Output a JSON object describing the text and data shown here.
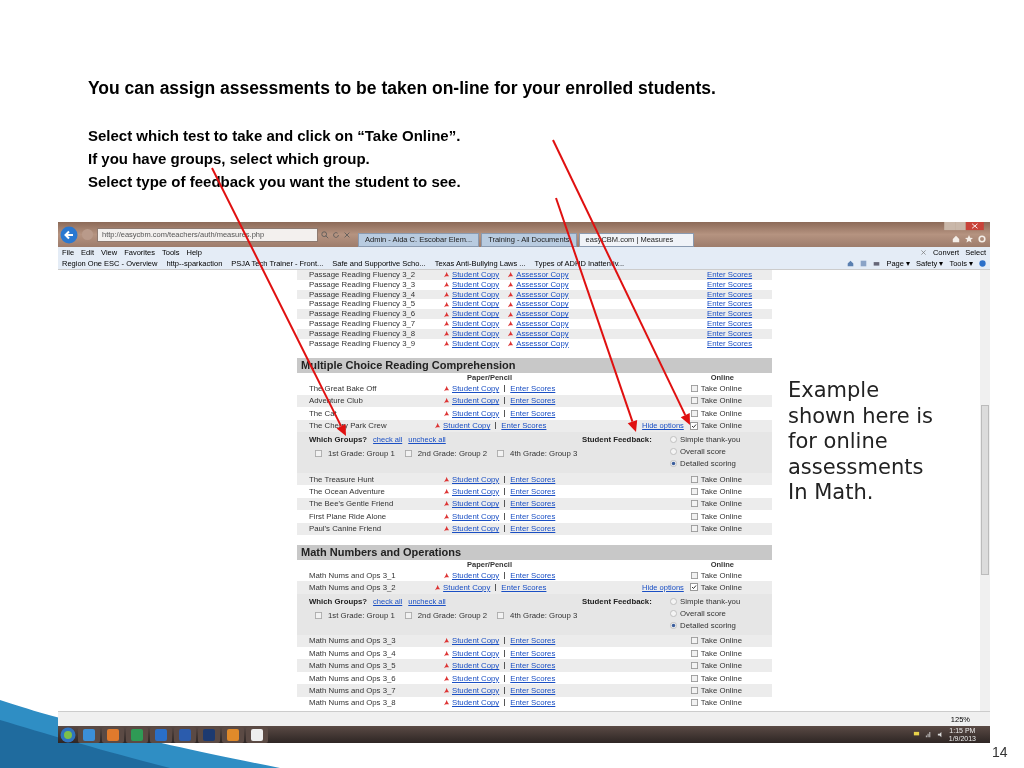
{
  "heading": "You can assign assessments to be taken on-line for your enrolled students.",
  "instructions": [
    "Select which test to take and click on “Take Online”.",
    "If you have groups, select which group.",
    "Select type of feedback you want the student to see."
  ],
  "browser": {
    "address": "http://easycbm.com/teachers/auth/measures.php",
    "tabs": [
      {
        "label": "Admin - Aida C. Escobar Elem...",
        "selected": false
      },
      {
        "label": "Training - All Documents",
        "selected": false
      },
      {
        "label": "easyCBM.com | Measures",
        "selected": true
      }
    ],
    "menu": [
      "File",
      "Edit",
      "View",
      "Favorites",
      "Tools",
      "Help"
    ],
    "favorites": [
      "Region One ESC - Overview",
      "http--sparkaction",
      "PSJA Tech Trainer - Front...",
      "Safe and Supportive Scho...",
      "Texas Anti-Bullying Laws ...",
      "Types of ADHD Inattentiv..."
    ],
    "command_top": [
      "Convert",
      "Select"
    ],
    "command_bottom": [
      "Page ▾",
      "Safety ▾",
      "Tools ▾"
    ],
    "zoom": "125%",
    "time": "1:15 PM",
    "date": "1/9/2013"
  },
  "passage_rows": [
    {
      "name": "Passage Reading Fluency 3_2",
      "student": "Student Copy",
      "assessor": "Assessor Copy",
      "enter": "Enter Scores"
    },
    {
      "name": "Passage Reading Fluency 3_3",
      "student": "Student Copy",
      "assessor": "Assessor Copy",
      "enter": "Enter Scores"
    },
    {
      "name": "Passage Reading Fluency 3_4",
      "student": "Student Copy",
      "assessor": "Assessor Copy",
      "enter": "Enter Scores"
    },
    {
      "name": "Passage Reading Fluency 3_5",
      "student": "Student Copy",
      "assessor": "Assessor Copy",
      "enter": "Enter Scores"
    },
    {
      "name": "Passage Reading Fluency 3_6",
      "student": "Student Copy",
      "assessor": "Assessor Copy",
      "enter": "Enter Scores"
    },
    {
      "name": "Passage Reading Fluency 3_7",
      "student": "Student Copy",
      "assessor": "Assessor Copy",
      "enter": "Enter Scores"
    },
    {
      "name": "Passage Reading Fluency 3_8",
      "student": "Student Copy",
      "assessor": "Assessor Copy",
      "enter": "Enter Scores"
    },
    {
      "name": "Passage Reading Fluency 3_9",
      "student": "Student Copy",
      "assessor": "Assessor Copy",
      "enter": "Enter Scores"
    }
  ],
  "sections": [
    {
      "title": "Multiple Choice Reading Comprehension",
      "paper_heading": "Paper/Pencil",
      "online_heading": "Online",
      "rows": [
        {
          "kind": "test",
          "name": "The Great Bake Off",
          "student": "Student Copy",
          "enter": "Enter Scores",
          "online": "Take Online",
          "checked": false
        },
        {
          "kind": "test",
          "name": "Adventure Club",
          "student": "Student Copy",
          "enter": "Enter Scores",
          "online": "Take Online",
          "checked": false
        },
        {
          "kind": "test",
          "name": "The Cat",
          "student": "Student Copy",
          "enter": "Enter Scores",
          "online": "Take Online",
          "checked": false
        },
        {
          "kind": "test",
          "name": "The Cherry Park Crew",
          "student": "Student Copy",
          "enter": "Enter Scores",
          "online": "Take Online",
          "checked": true,
          "hide": "Hide options"
        },
        {
          "kind": "options",
          "groups_label": "Which Groups?",
          "check_all": "check all",
          "uncheck_all": "uncheck all",
          "groups": [
            {
              "label": "1st Grade: Group 1",
              "checked": false
            },
            {
              "label": "2nd Grade: Group 2",
              "checked": false
            },
            {
              "label": "4th Grade: Group 3",
              "checked": false
            }
          ],
          "feedback_label": "Student Feedback:",
          "feedback": [
            {
              "label": "Simple thank-you",
              "selected": false
            },
            {
              "label": "Overall score",
              "selected": false
            },
            {
              "label": "Detailed scoring",
              "selected": true
            }
          ]
        },
        {
          "kind": "test",
          "name": "The Treasure Hunt",
          "student": "Student Copy",
          "enter": "Enter Scores",
          "online": "Take Online",
          "checked": false
        },
        {
          "kind": "test",
          "name": "The Ocean Adventure",
          "student": "Student Copy",
          "enter": "Enter Scores",
          "online": "Take Online",
          "checked": false
        },
        {
          "kind": "test",
          "name": "The Bee's Gentle Friend",
          "student": "Student Copy",
          "enter": "Enter Scores",
          "online": "Take Online",
          "checked": false
        },
        {
          "kind": "test",
          "name": "First Plane Ride Alone",
          "student": "Student Copy",
          "enter": "Enter Scores",
          "online": "Take Online",
          "checked": false
        },
        {
          "kind": "test",
          "name": "Paul's Canine Friend",
          "student": "Student Copy",
          "enter": "Enter Scores",
          "online": "Take Online",
          "checked": false
        }
      ]
    },
    {
      "title": "Math Numbers and Operations",
      "paper_heading": "Paper/Pencil",
      "online_heading": "Online",
      "rows": [
        {
          "kind": "test",
          "name": "Math Nums and Ops 3_1",
          "student": "Student Copy",
          "enter": "Enter Scores",
          "online": "Take Online",
          "checked": false
        },
        {
          "kind": "test",
          "name": "Math Nums and Ops 3_2",
          "student": "Student Copy",
          "enter": "Enter Scores",
          "online": "Take Online",
          "checked": true,
          "hide": "Hide options"
        },
        {
          "kind": "options",
          "groups_label": "Which Groups?",
          "check_all": "check all",
          "uncheck_all": "uncheck all",
          "groups": [
            {
              "label": "1st Grade: Group 1",
              "checked": false
            },
            {
              "label": "2nd Grade: Group 2",
              "checked": false
            },
            {
              "label": "4th Grade: Group 3",
              "checked": false
            }
          ],
          "feedback_label": "Student Feedback:",
          "feedback": [
            {
              "label": "Simple thank-you",
              "selected": false
            },
            {
              "label": "Overall score",
              "selected": false
            },
            {
              "label": "Detailed scoring",
              "selected": true
            }
          ]
        },
        {
          "kind": "test",
          "name": "Math Nums and Ops 3_3",
          "student": "Student Copy",
          "enter": "Enter Scores",
          "online": "Take Online",
          "checked": false
        },
        {
          "kind": "test",
          "name": "Math Nums and Ops 3_4",
          "student": "Student Copy",
          "enter": "Enter Scores",
          "online": "Take Online",
          "checked": false
        },
        {
          "kind": "test",
          "name": "Math Nums and Ops 3_5",
          "student": "Student Copy",
          "enter": "Enter Scores",
          "online": "Take Online",
          "checked": false
        },
        {
          "kind": "test",
          "name": "Math Nums and Ops 3_6",
          "student": "Student Copy",
          "enter": "Enter Scores",
          "online": "Take Online",
          "checked": false
        },
        {
          "kind": "test",
          "name": "Math Nums and Ops 3_7",
          "student": "Student Copy",
          "enter": "Enter Scores",
          "online": "Take Online",
          "checked": false
        },
        {
          "kind": "test",
          "name": "Math Nums and Ops 3_8",
          "student": "Student Copy",
          "enter": "Enter Scores",
          "online": "Take Online",
          "checked": false
        }
      ]
    }
  ],
  "callout": "Example shown here is for online assessments In Math.",
  "slide_number": "14"
}
